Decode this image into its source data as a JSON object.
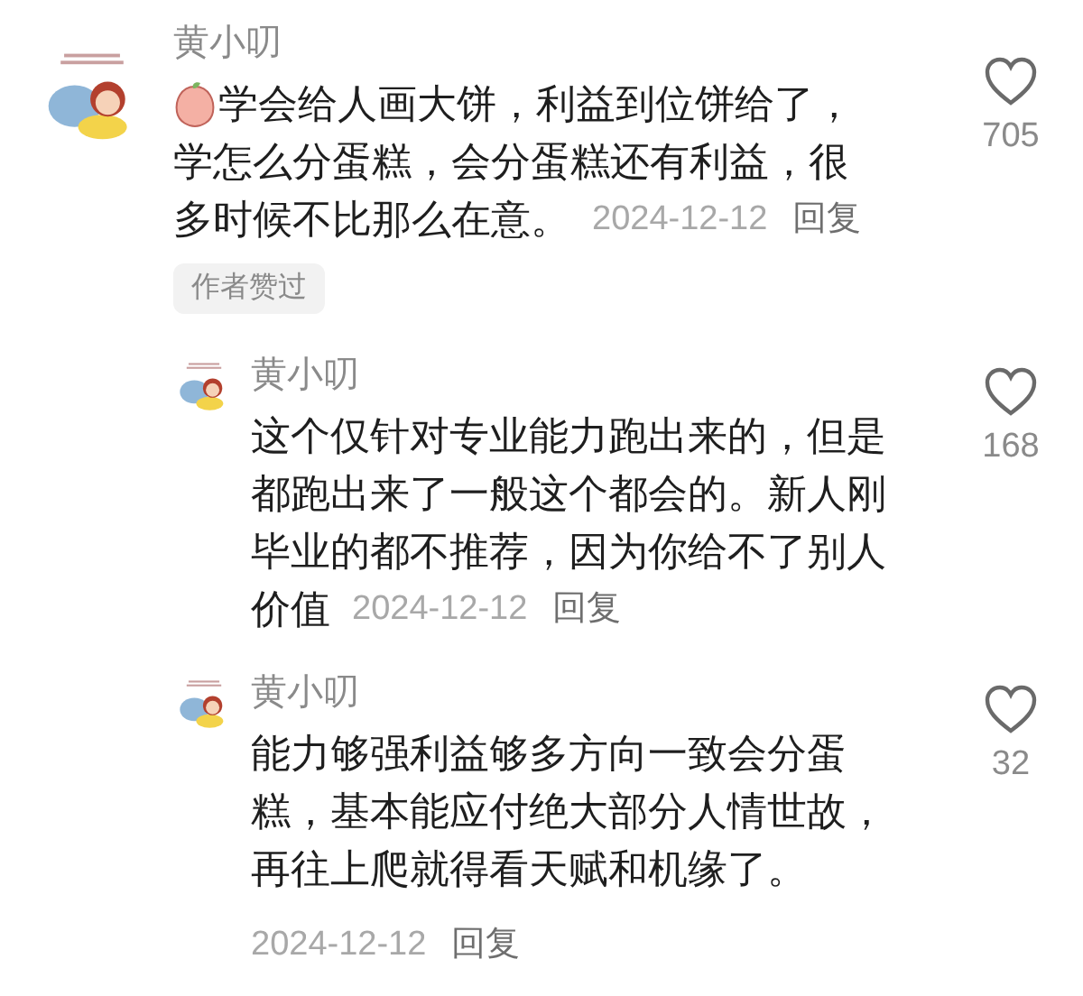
{
  "comments": [
    {
      "author": "黄小叨",
      "sticker": true,
      "lines": [
        "学会给人画大饼，利益到位饼给了，",
        "学怎么分蛋糕，会分蛋糕还有利益，很",
        "多时候不比那么在意。"
      ],
      "date_inline": true,
      "date": "2024-12-12",
      "reply": "回复",
      "likes": "705",
      "badge": "作者赞过",
      "replies": [
        {
          "author": "黄小叨",
          "lines": [
            "这个仅针对专业能力跑出来的，但是",
            "都跑出来了一般这个都会的。新人刚",
            "毕业的都不推荐，因为你给不了别人",
            "价值"
          ],
          "date_inline": true,
          "date": "2024-12-12",
          "reply": "回复",
          "likes": "168"
        },
        {
          "author": "黄小叨",
          "lines": [
            "能力够强利益够多方向一致会分蛋",
            "糕，基本能应付绝大部分人情世故，",
            "再往上爬就得看天赋和机缘了。"
          ],
          "date_inline": false,
          "date": "2024-12-12",
          "reply": "回复",
          "likes": "32"
        }
      ]
    }
  ]
}
